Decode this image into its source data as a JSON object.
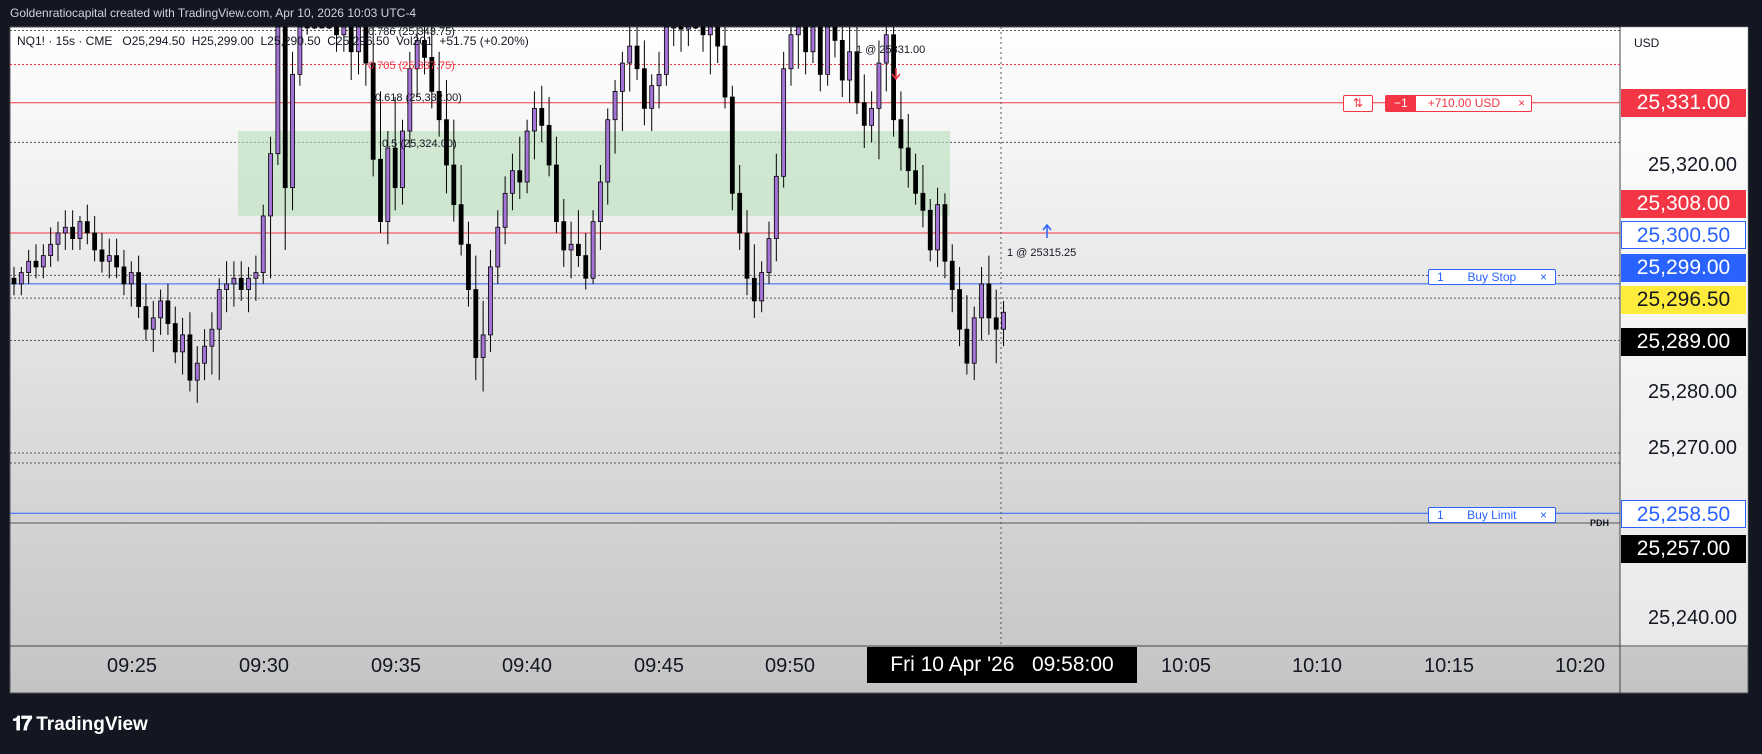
{
  "header": {
    "attribution": "Goldenratiocapital created with TradingView.com, Apr 10, 2026 10:03 UTC-4"
  },
  "legend": {
    "symbol": "NQ1! · 15s · CME",
    "open": "O25,294.50",
    "high": "H25,299.00",
    "low": "L25,290.50",
    "close": "C25,296.50",
    "volume": "Vol201",
    "change": "+51.75 (+0.20%)"
  },
  "price_axis": {
    "currency": "USD",
    "ticks": [
      "25,320.00",
      "25,280.00",
      "25,270.00",
      "25,240.00"
    ],
    "badges": [
      {
        "label": "25,331.00",
        "bg": "#f23645",
        "fg": "#ffffff"
      },
      {
        "label": "25,308.00",
        "bg": "#f23645",
        "fg": "#ffffff"
      },
      {
        "label": "25,300.50",
        "bg": "#ffffff",
        "fg": "#2962ff"
      },
      {
        "label": "25,299.00",
        "bg": "#2962ff",
        "fg": "#ffffff"
      },
      {
        "label": "25,296.50",
        "bg": "#ffeb3b",
        "fg": "#131722"
      },
      {
        "label": "25,289.00",
        "bg": "#000000",
        "fg": "#ffffff"
      },
      {
        "label": "25,258.50",
        "bg": "#ffffff",
        "fg": "#2962ff"
      },
      {
        "label": "25,257.00",
        "bg": "#000000",
        "fg": "#ffffff"
      }
    ]
  },
  "time_axis": {
    "ticks": [
      "09:25",
      "09:30",
      "09:35",
      "09:40",
      "09:45",
      "09:50",
      "10:05",
      "10:10",
      "10:15",
      "10:20"
    ],
    "crosshair_label": "Fri 10 Apr '26   09:58:00"
  },
  "position": {
    "reverse_icon": "reverse-icon",
    "qty": "−1",
    "pnl": "+710.00 USD",
    "close": "×"
  },
  "orders": [
    {
      "qty": "1",
      "type": "Buy Stop",
      "close": "×",
      "price": "25,299.00"
    },
    {
      "qty": "1",
      "type": "Buy Limit",
      "close": "×",
      "price": "25,258.50"
    }
  ],
  "annotations": {
    "fib_0786": "0.786 (25,343.75)",
    "fib_0705": "0.705 (25,337.75)",
    "fib_0618": "0.618 (25,332.00)",
    "fib_05": "0.5 (25,324.00)",
    "fill_sell": "1 @ 25331.00",
    "fill_buy": "1 @ 25315.25",
    "pdh": "PDH"
  },
  "colors": {
    "bull_body": "#a374d6",
    "bear_body": "#000000",
    "buy_order": "#2962ff",
    "position": "#f23645",
    "fvg_zone": "#b8dfb9"
  },
  "footer": {
    "brand": "TradingView"
  },
  "candles": [
    [
      25300,
      25302,
      25297,
      25299
    ],
    [
      25299,
      25302,
      25297,
      25301
    ],
    [
      25301,
      25305,
      25299,
      25303
    ],
    [
      25303,
      25306,
      25300,
      25302
    ],
    [
      25302,
      25306,
      25300,
      25304
    ],
    [
      25304,
      25309,
      25302,
      25306
    ],
    [
      25306,
      25310,
      25303,
      25308
    ],
    [
      25308,
      25312,
      25305,
      25309
    ],
    [
      25309,
      25312,
      25305,
      25307
    ],
    [
      25307,
      25311,
      25305,
      25310
    ],
    [
      25310,
      25313,
      25306,
      25308
    ],
    [
      25308,
      25311,
      25303,
      25305
    ],
    [
      25305,
      25308,
      25301,
      25303
    ],
    [
      25303,
      25307,
      25300,
      25304
    ],
    [
      25304,
      25307,
      25300,
      25302
    ],
    [
      25302,
      25305,
      25297,
      25299
    ],
    [
      25299,
      25303,
      25295,
      25301
    ],
    [
      25301,
      25304,
      25293,
      25295
    ],
    [
      25295,
      25299,
      25289,
      25291
    ],
    [
      25291,
      25296,
      25287,
      25293
    ],
    [
      25293,
      25298,
      25290,
      25296
    ],
    [
      25296,
      25299,
      25290,
      25292
    ],
    [
      25292,
      25295,
      25285,
      25287
    ],
    [
      25287,
      25293,
      25283,
      25290
    ],
    [
      25290,
      25294,
      25280,
      25282
    ],
    [
      25282,
      25288,
      25278,
      25285
    ],
    [
      25285,
      25291,
      25282,
      25288
    ],
    [
      25288,
      25294,
      25283,
      25291
    ],
    [
      25291,
      25300,
      25282,
      25298
    ],
    [
      25298,
      25303,
      25294,
      25299
    ],
    [
      25299,
      25303,
      25295,
      25300
    ],
    [
      25300,
      25303,
      25296,
      25298
    ],
    [
      25298,
      25302,
      25294,
      25300
    ],
    [
      25300,
      25304,
      25296,
      25301
    ],
    [
      25301,
      25313,
      25299,
      25311
    ],
    [
      25311,
      25325,
      25300,
      25322
    ],
    [
      25322,
      25360,
      25320,
      25356
    ],
    [
      25356,
      25360,
      25305,
      25316
    ],
    [
      25316,
      25340,
      25312,
      25336
    ],
    [
      25336,
      25362,
      25334,
      25355
    ],
    [
      25355,
      25362,
      25343,
      25347
    ],
    [
      25347,
      25360,
      25344,
      25358
    ],
    [
      25358,
      25362,
      25346,
      25350
    ],
    [
      25350,
      25355,
      25344,
      25353
    ],
    [
      25353,
      25356,
      25340,
      25343
    ],
    [
      25343,
      25355,
      25340,
      25352
    ],
    [
      25352,
      25355,
      25335,
      25340
    ],
    [
      25340,
      25350,
      25336,
      25346
    ],
    [
      25346,
      25358,
      25334,
      25338
    ],
    [
      25338,
      25345,
      25318,
      25321
    ],
    [
      25321,
      25333,
      25308,
      25310
    ],
    [
      25310,
      25326,
      25306,
      25323
    ],
    [
      25323,
      25332,
      25312,
      25316
    ],
    [
      25316,
      25328,
      25313,
      25326
    ],
    [
      25326,
      25340,
      25323,
      25337
    ],
    [
      25337,
      25345,
      25332,
      25342
    ],
    [
      25342,
      25350,
      25336,
      25339
    ],
    [
      25339,
      25345,
      25330,
      25333
    ],
    [
      25333,
      25340,
      25325,
      25328
    ],
    [
      25328,
      25335,
      25315,
      25320
    ],
    [
      25320,
      25328,
      25310,
      25313
    ],
    [
      25313,
      25320,
      25304,
      25306
    ],
    [
      25306,
      25310,
      25295,
      25298
    ],
    [
      25298,
      25304,
      25282,
      25286
    ],
    [
      25286,
      25296,
      25280,
      25290
    ],
    [
      25290,
      25305,
      25287,
      25302
    ],
    [
      25302,
      25312,
      25299,
      25309
    ],
    [
      25309,
      25318,
      25306,
      25315
    ],
    [
      25315,
      25322,
      25312,
      25319
    ],
    [
      25319,
      25325,
      25314,
      25317
    ],
    [
      25317,
      25328,
      25315,
      25326
    ],
    [
      25326,
      25333,
      25321,
      25330
    ],
    [
      25330,
      25334,
      25324,
      25327
    ],
    [
      25327,
      25332,
      25318,
      25320
    ],
    [
      25320,
      25325,
      25308,
      25310
    ],
    [
      25310,
      25314,
      25302,
      25305
    ],
    [
      25305,
      25310,
      25300,
      25306
    ],
    [
      25306,
      25312,
      25302,
      25304
    ],
    [
      25304,
      25308,
      25298,
      25300
    ],
    [
      25300,
      25312,
      25299,
      25310
    ],
    [
      25310,
      25320,
      25305,
      25317
    ],
    [
      25317,
      25330,
      25313,
      25328
    ],
    [
      25328,
      25335,
      25322,
      25333
    ],
    [
      25333,
      25340,
      25326,
      25338
    ],
    [
      25338,
      25345,
      25333,
      25341
    ],
    [
      25341,
      25346,
      25335,
      25337
    ],
    [
      25337,
      25342,
      25327,
      25330
    ],
    [
      25330,
      25336,
      25326,
      25334
    ],
    [
      25334,
      25340,
      25330,
      25336
    ],
    [
      25336,
      25348,
      25334,
      25346
    ],
    [
      25346,
      25357,
      25341,
      25352
    ],
    [
      25352,
      25357,
      25340,
      25344
    ],
    [
      25344,
      25356,
      25341,
      25354
    ],
    [
      25354,
      25358,
      25344,
      25349
    ],
    [
      25349,
      25355,
      25340,
      25343
    ],
    [
      25343,
      25350,
      25336,
      25346
    ],
    [
      25346,
      25352,
      25338,
      25341
    ],
    [
      25341,
      25345,
      25330,
      25332
    ],
    [
      25332,
      25334,
      25312,
      25315
    ],
    [
      25315,
      25320,
      25305,
      25308
    ],
    [
      25308,
      25312,
      25297,
      25300
    ],
    [
      25300,
      25306,
      25293,
      25296
    ],
    [
      25296,
      25303,
      25294,
      25301
    ],
    [
      25301,
      25310,
      25299,
      25307
    ],
    [
      25307,
      25322,
      25303,
      25318
    ],
    [
      25318,
      25340,
      25316,
      25337
    ],
    [
      25337,
      25350,
      25334,
      25343
    ],
    [
      25343,
      25351,
      25337,
      25348
    ],
    [
      25348,
      25353,
      25336,
      25340
    ],
    [
      25340,
      25350,
      25338,
      25346
    ],
    [
      25346,
      25352,
      25333,
      25336
    ],
    [
      25336,
      25348,
      25334,
      25345
    ],
    [
      25345,
      25351,
      25339,
      25342
    ],
    [
      25342,
      25347,
      25332,
      25335
    ],
    [
      25335,
      25345,
      25331,
      25340
    ],
    [
      25340,
      25346,
      25329,
      25331
    ],
    [
      25331,
      25336,
      25323,
      25327
    ],
    [
      25327,
      25333,
      25324,
      25330
    ],
    [
      25330,
      25342,
      25321,
      25338
    ],
    [
      25338,
      25346,
      25333,
      25343
    ],
    [
      25343,
      25347,
      25325,
      25328
    ],
    [
      25328,
      25333,
      25319,
      25323
    ],
    [
      25323,
      25329,
      25316,
      25319
    ],
    [
      25319,
      25322,
      25313,
      25315
    ],
    [
      25315,
      25320,
      25309,
      25312
    ],
    [
      25312,
      25314,
      25303,
      25305
    ],
    [
      25305,
      25316,
      25302,
      25313
    ],
    [
      25313,
      25315,
      25300,
      25303
    ],
    [
      25303,
      25306,
      25294,
      25298
    ],
    [
      25298,
      25302,
      25288,
      25291
    ],
    [
      25291,
      25297,
      25283,
      25285
    ],
    [
      25285,
      25295,
      25282,
      25293
    ],
    [
      25293,
      25302,
      25289,
      25299
    ],
    [
      25299,
      25304,
      25290,
      25293
    ],
    [
      25293,
      25298,
      25285,
      25291
    ],
    [
      25291,
      25296,
      25288,
      25294
    ]
  ]
}
